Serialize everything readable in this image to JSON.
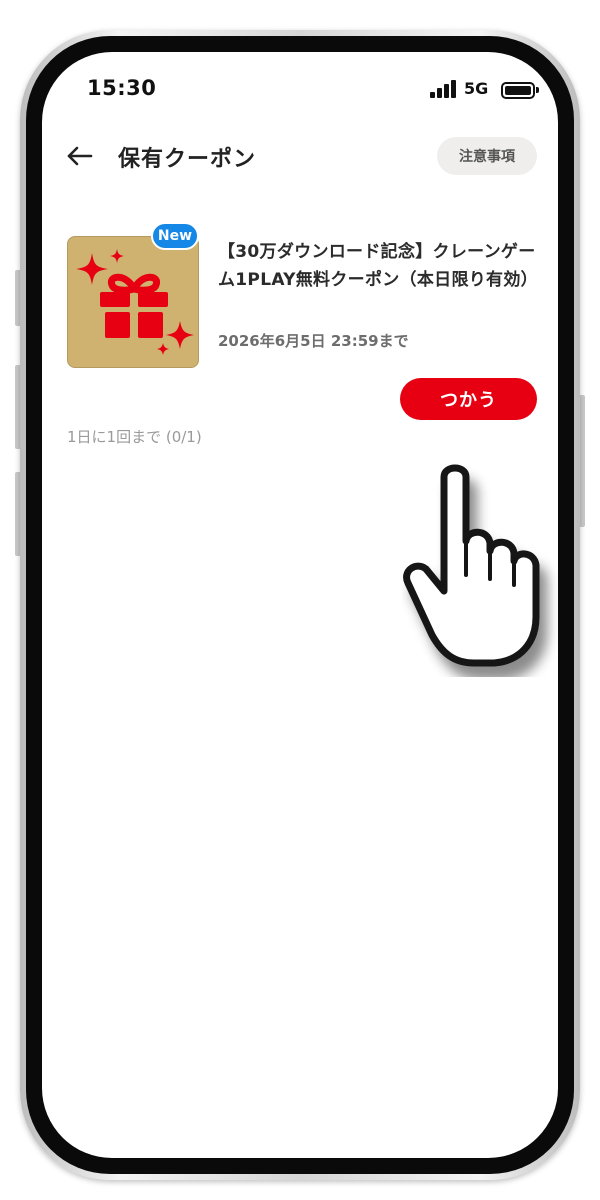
{
  "status_bar": {
    "time": "15:30",
    "network": "5G"
  },
  "header": {
    "title": "保有クーポン",
    "notice_label": "注意事項",
    "back_icon": "arrow-left-icon"
  },
  "coupon": {
    "badge": "New",
    "title": "【30万ダウンロード記念】クレーンゲーム1PLAY無料クーポン（本日限り有効）",
    "expiry": "2026年6月5日 23:59まで",
    "use_label": "つかう",
    "limit": "1日に1回まで (0/1)",
    "thumbnail_icon": "gift-icon"
  },
  "colors": {
    "accent": "#e60012",
    "badge": "#1587e6",
    "thumbnail_bg": "#cfb170"
  }
}
